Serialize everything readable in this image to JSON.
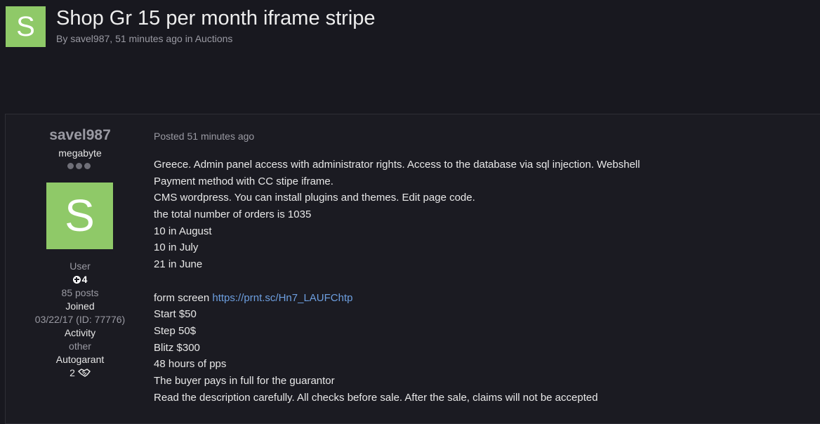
{
  "topic": {
    "avatar_letter": "S",
    "title": "Shop Gr 15 per month iframe stripe",
    "meta_by": "By",
    "author": "savel987",
    "meta_sep": ",",
    "time": "51 minutes ago",
    "meta_in": "in",
    "forum": "Auctions"
  },
  "author": {
    "name": "savel987",
    "rank": "megabyte",
    "avatar_letter": "S",
    "group": "User",
    "reputation": "4",
    "posts": "85 posts",
    "joined_label": "Joined",
    "joined_value": "03/22/17 (ID: 77776)",
    "activity_label": "Activity",
    "activity_value": "other",
    "autogarant_label": "Autogarant",
    "autogarant_value": "2"
  },
  "post": {
    "posted_label": "Posted",
    "posted_time": "51 minutes ago",
    "lines": [
      "Greece. Admin panel access with administrator rights. Access to the database via sql injection. Webshell",
      "Payment method with CC stipe iframe.",
      "CMS wordpress. You can install plugins and themes. Edit page code.",
      "the total number of orders is 1035",
      "10 in August",
      "10 in July",
      "21 in June",
      "",
      "form screen",
      "Start $50",
      "Step 50$",
      "Blitz $300",
      "48 hours of pps",
      "The buyer pays in full for the guarantor",
      "Read the description carefully. All checks before sale. After the sale, claims will not be accepted"
    ],
    "link_text": "https://prnt.sc/Hn7_LAUFChtp"
  },
  "colors": {
    "background": "#18181f",
    "avatar": "#8fc968",
    "link": "#6d9fe0"
  },
  "icons": [
    "reputation-plus-icon",
    "handshake-icon"
  ]
}
